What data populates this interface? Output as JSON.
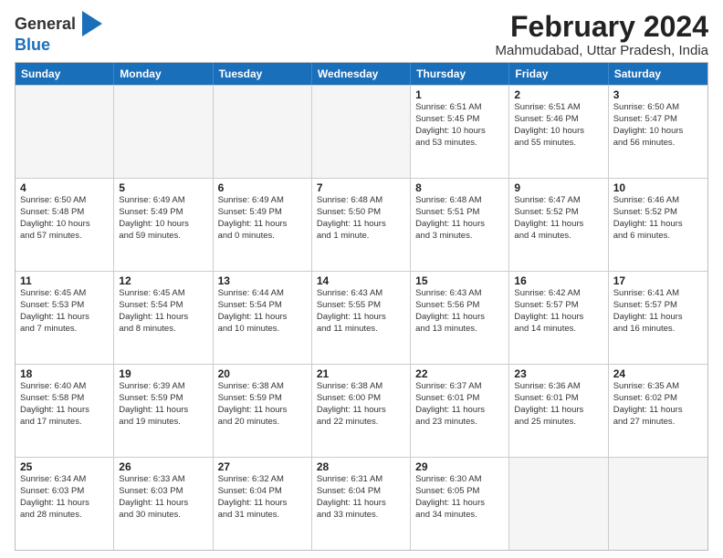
{
  "logo": {
    "general": "General",
    "blue": "Blue"
  },
  "title": "February 2024",
  "subtitle": "Mahmudabad, Uttar Pradesh, India",
  "header_days": [
    "Sunday",
    "Monday",
    "Tuesday",
    "Wednesday",
    "Thursday",
    "Friday",
    "Saturday"
  ],
  "rows": [
    [
      {
        "day": "",
        "detail": ""
      },
      {
        "day": "",
        "detail": ""
      },
      {
        "day": "",
        "detail": ""
      },
      {
        "day": "",
        "detail": ""
      },
      {
        "day": "1",
        "detail": "Sunrise: 6:51 AM\nSunset: 5:45 PM\nDaylight: 10 hours\nand 53 minutes."
      },
      {
        "day": "2",
        "detail": "Sunrise: 6:51 AM\nSunset: 5:46 PM\nDaylight: 10 hours\nand 55 minutes."
      },
      {
        "day": "3",
        "detail": "Sunrise: 6:50 AM\nSunset: 5:47 PM\nDaylight: 10 hours\nand 56 minutes."
      }
    ],
    [
      {
        "day": "4",
        "detail": "Sunrise: 6:50 AM\nSunset: 5:48 PM\nDaylight: 10 hours\nand 57 minutes."
      },
      {
        "day": "5",
        "detail": "Sunrise: 6:49 AM\nSunset: 5:49 PM\nDaylight: 10 hours\nand 59 minutes."
      },
      {
        "day": "6",
        "detail": "Sunrise: 6:49 AM\nSunset: 5:49 PM\nDaylight: 11 hours\nand 0 minutes."
      },
      {
        "day": "7",
        "detail": "Sunrise: 6:48 AM\nSunset: 5:50 PM\nDaylight: 11 hours\nand 1 minute."
      },
      {
        "day": "8",
        "detail": "Sunrise: 6:48 AM\nSunset: 5:51 PM\nDaylight: 11 hours\nand 3 minutes."
      },
      {
        "day": "9",
        "detail": "Sunrise: 6:47 AM\nSunset: 5:52 PM\nDaylight: 11 hours\nand 4 minutes."
      },
      {
        "day": "10",
        "detail": "Sunrise: 6:46 AM\nSunset: 5:52 PM\nDaylight: 11 hours\nand 6 minutes."
      }
    ],
    [
      {
        "day": "11",
        "detail": "Sunrise: 6:45 AM\nSunset: 5:53 PM\nDaylight: 11 hours\nand 7 minutes."
      },
      {
        "day": "12",
        "detail": "Sunrise: 6:45 AM\nSunset: 5:54 PM\nDaylight: 11 hours\nand 8 minutes."
      },
      {
        "day": "13",
        "detail": "Sunrise: 6:44 AM\nSunset: 5:54 PM\nDaylight: 11 hours\nand 10 minutes."
      },
      {
        "day": "14",
        "detail": "Sunrise: 6:43 AM\nSunset: 5:55 PM\nDaylight: 11 hours\nand 11 minutes."
      },
      {
        "day": "15",
        "detail": "Sunrise: 6:43 AM\nSunset: 5:56 PM\nDaylight: 11 hours\nand 13 minutes."
      },
      {
        "day": "16",
        "detail": "Sunrise: 6:42 AM\nSunset: 5:57 PM\nDaylight: 11 hours\nand 14 minutes."
      },
      {
        "day": "17",
        "detail": "Sunrise: 6:41 AM\nSunset: 5:57 PM\nDaylight: 11 hours\nand 16 minutes."
      }
    ],
    [
      {
        "day": "18",
        "detail": "Sunrise: 6:40 AM\nSunset: 5:58 PM\nDaylight: 11 hours\nand 17 minutes."
      },
      {
        "day": "19",
        "detail": "Sunrise: 6:39 AM\nSunset: 5:59 PM\nDaylight: 11 hours\nand 19 minutes."
      },
      {
        "day": "20",
        "detail": "Sunrise: 6:38 AM\nSunset: 5:59 PM\nDaylight: 11 hours\nand 20 minutes."
      },
      {
        "day": "21",
        "detail": "Sunrise: 6:38 AM\nSunset: 6:00 PM\nDaylight: 11 hours\nand 22 minutes."
      },
      {
        "day": "22",
        "detail": "Sunrise: 6:37 AM\nSunset: 6:01 PM\nDaylight: 11 hours\nand 23 minutes."
      },
      {
        "day": "23",
        "detail": "Sunrise: 6:36 AM\nSunset: 6:01 PM\nDaylight: 11 hours\nand 25 minutes."
      },
      {
        "day": "24",
        "detail": "Sunrise: 6:35 AM\nSunset: 6:02 PM\nDaylight: 11 hours\nand 27 minutes."
      }
    ],
    [
      {
        "day": "25",
        "detail": "Sunrise: 6:34 AM\nSunset: 6:03 PM\nDaylight: 11 hours\nand 28 minutes."
      },
      {
        "day": "26",
        "detail": "Sunrise: 6:33 AM\nSunset: 6:03 PM\nDaylight: 11 hours\nand 30 minutes."
      },
      {
        "day": "27",
        "detail": "Sunrise: 6:32 AM\nSunset: 6:04 PM\nDaylight: 11 hours\nand 31 minutes."
      },
      {
        "day": "28",
        "detail": "Sunrise: 6:31 AM\nSunset: 6:04 PM\nDaylight: 11 hours\nand 33 minutes."
      },
      {
        "day": "29",
        "detail": "Sunrise: 6:30 AM\nSunset: 6:05 PM\nDaylight: 11 hours\nand 34 minutes."
      },
      {
        "day": "",
        "detail": ""
      },
      {
        "day": "",
        "detail": ""
      }
    ]
  ]
}
